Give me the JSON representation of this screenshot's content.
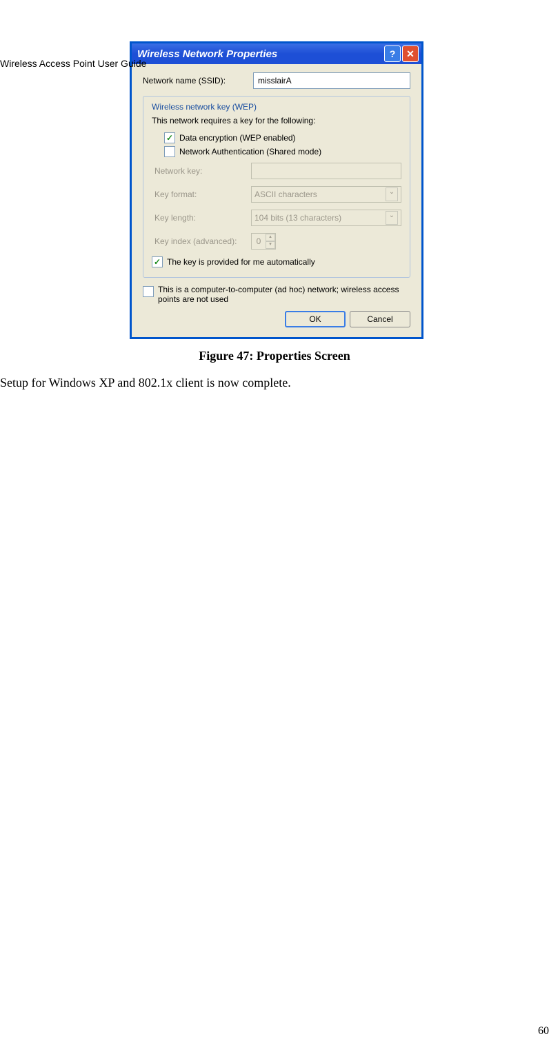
{
  "page": {
    "header": "Wireless Access Point User Guide",
    "page_number": "60",
    "figure_caption": "Figure 47: Properties Screen",
    "body_text": "Setup for Windows XP and 802.1x client is now complete."
  },
  "dialog": {
    "title": "Wireless Network Properties",
    "ssid_label": "Network name (SSID):",
    "ssid_value": "misslairA",
    "group_legend": "Wireless network key (WEP)",
    "group_note": "This network requires a key for the following:",
    "cb_data_encryption": "Data encryption (WEP enabled)",
    "cb_network_auth": "Network Authentication (Shared mode)",
    "lbl_network_key": "Network key:",
    "lbl_key_format": "Key format:",
    "val_key_format": "ASCII characters",
    "lbl_key_length": "Key length:",
    "val_key_length": "104 bits (13 characters)",
    "lbl_key_index": "Key index (advanced):",
    "val_key_index": "0",
    "cb_auto_key": "The key is provided for me automatically",
    "cb_adhoc": "This is a computer-to-computer (ad hoc) network; wireless access points are not used",
    "btn_ok": "OK",
    "btn_cancel": "Cancel"
  }
}
